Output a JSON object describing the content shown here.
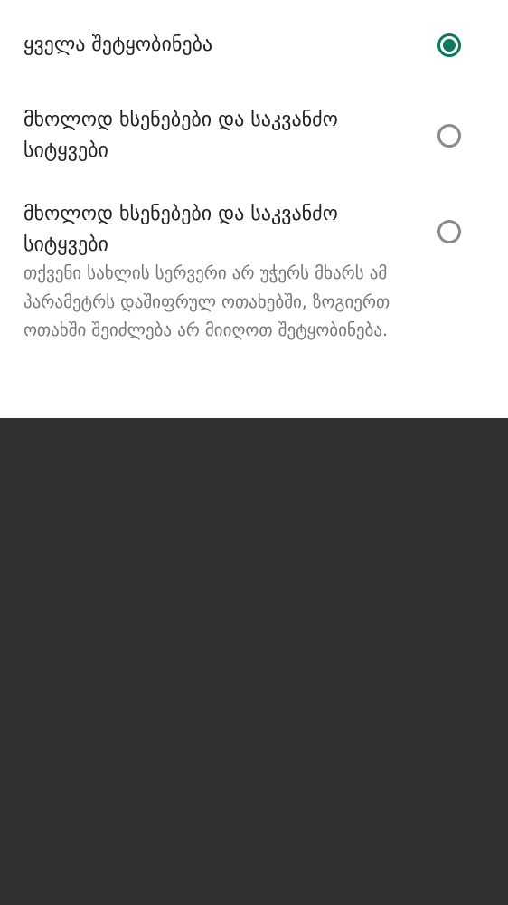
{
  "options": [
    {
      "label": "ყველა შეტყობინება",
      "selected": true
    },
    {
      "label": "მხოლოდ ხსენებები და საკვანძო სიტყვები",
      "selected": false
    },
    {
      "label": "მხოლოდ ხსენებები და საკვანძო სიტყვები",
      "description": "თქვენი სახლის სერვერი არ უჭერს მხარს ამ პარამეტრს დაშიფრულ ოთახებში, ზოგიერთ ოთახში შეიძლება არ მიიღოთ შეტყობინება.",
      "selected": false
    }
  ],
  "colors": {
    "accent": "#0b7a5e",
    "sheet_background": "#ffffff",
    "scrim": "#303030"
  }
}
